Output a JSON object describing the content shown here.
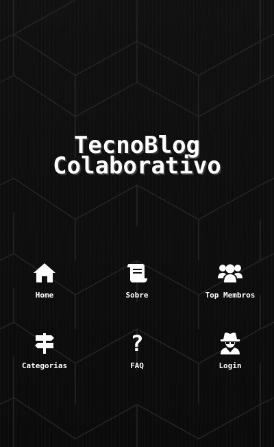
{
  "site": {
    "title_line1": "TecnoBlog",
    "title_line2": "Colaborativo"
  },
  "nav": {
    "items": [
      {
        "label": "Home",
        "icon": "home-icon"
      },
      {
        "label": "Sobre",
        "icon": "scroll-icon"
      },
      {
        "label": "Top Membros",
        "icon": "users-icon"
      },
      {
        "label": "Categorias",
        "icon": "signpost-icon"
      },
      {
        "label": "FAQ",
        "icon": "question-icon",
        "glyph": "?"
      },
      {
        "label": "Login",
        "icon": "user-secret-icon"
      }
    ]
  },
  "theme": {
    "background": "#0d0d0d",
    "text": "#ffffff",
    "hex_lines": "#2a2a2a"
  }
}
